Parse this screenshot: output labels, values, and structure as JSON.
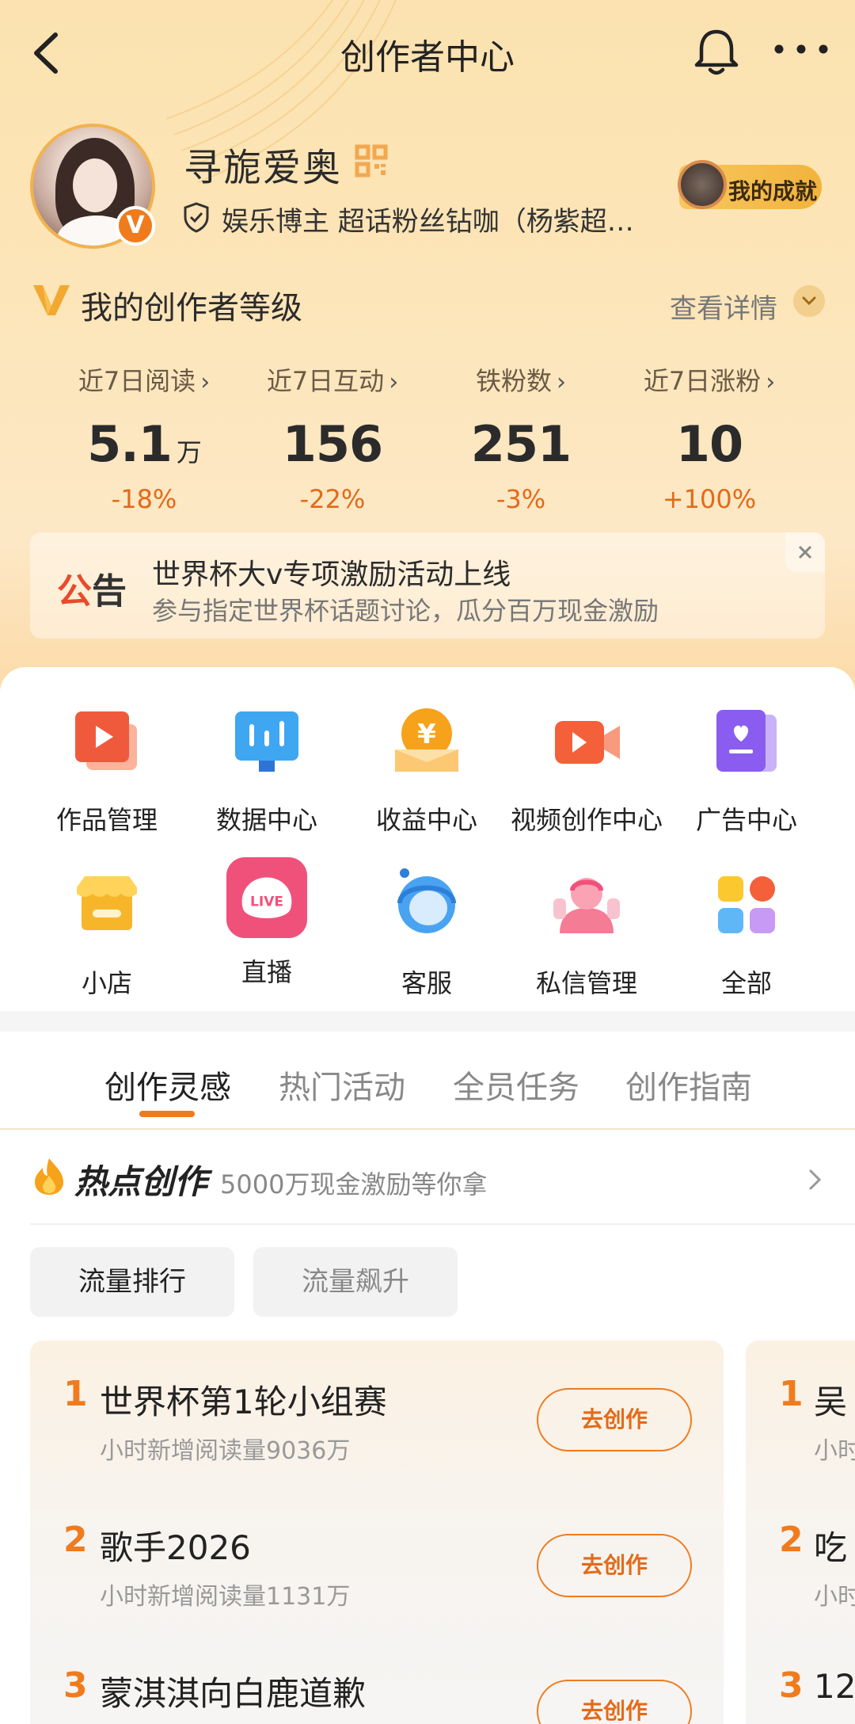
{
  "nav": {
    "title": "创作者中心",
    "back_icon": "back-arrow-icon",
    "bell_icon": "bell-icon",
    "more_icon": "more-dots-icon"
  },
  "profile": {
    "username": "寻旎爱奥",
    "verified_badge": "V",
    "tag": "娱乐博主 超话粉丝钻咖（杨紫超…",
    "achievement": "我的成就"
  },
  "level": {
    "title": "我的创作者等级",
    "detail": "查看详情"
  },
  "stats": [
    {
      "label": "近7日阅读",
      "value": "5.1",
      "unit": "万",
      "change": "-18%"
    },
    {
      "label": "近7日互动",
      "value": "156",
      "unit": "",
      "change": "-22%"
    },
    {
      "label": "铁粉数",
      "value": "251",
      "unit": "",
      "change": "-3%"
    },
    {
      "label": "近7日涨粉",
      "value": "10",
      "unit": "",
      "change": "+100%"
    }
  ],
  "notice": {
    "tag_a": "公",
    "tag_b": "告",
    "title": "世界杯大v专项激励活动上线",
    "subtitle": "参与指定世界杯话题讨论，瓜分百万现金激励"
  },
  "tools": [
    {
      "label": "作品管理",
      "icon": "works-icon"
    },
    {
      "label": "数据中心",
      "icon": "data-icon"
    },
    {
      "label": "收益中心",
      "icon": "income-icon"
    },
    {
      "label": "视频创作中心",
      "icon": "video-icon"
    },
    {
      "label": "广告中心",
      "icon": "ad-icon"
    },
    {
      "label": "小店",
      "icon": "shop-icon"
    },
    {
      "label": "直播",
      "icon": "live-icon"
    },
    {
      "label": "客服",
      "icon": "support-icon"
    },
    {
      "label": "私信管理",
      "icon": "message-icon"
    },
    {
      "label": "全部",
      "icon": "all-icon"
    }
  ],
  "tabs": [
    "创作灵感",
    "热门活动",
    "全员任务",
    "创作指南"
  ],
  "hot": {
    "title": "热点创作",
    "subtitle": "5000万现金激励等你拿"
  },
  "chips": [
    "流量排行",
    "流量飙升"
  ],
  "ranking_left": [
    {
      "rank": "1",
      "topic": "世界杯第1轮小组赛",
      "meta": "小时新增阅读量9036万",
      "button": "去创作"
    },
    {
      "rank": "2",
      "topic": "歌手2026",
      "meta": "小时新增阅读量1131万",
      "button": "去创作"
    },
    {
      "rank": "3",
      "topic": "蒙淇淇向白鹿道歉",
      "meta": "",
      "button": "去创作"
    }
  ],
  "ranking_right": [
    {
      "rank": "1",
      "topic": "吴",
      "meta": "小时"
    },
    {
      "rank": "2",
      "topic": "吃",
      "meta": "小时"
    },
    {
      "rank": "3",
      "topic": "12",
      "meta": ""
    }
  ],
  "colors": {
    "accent": "#f07b1d",
    "background_top": "#fce5b8"
  }
}
